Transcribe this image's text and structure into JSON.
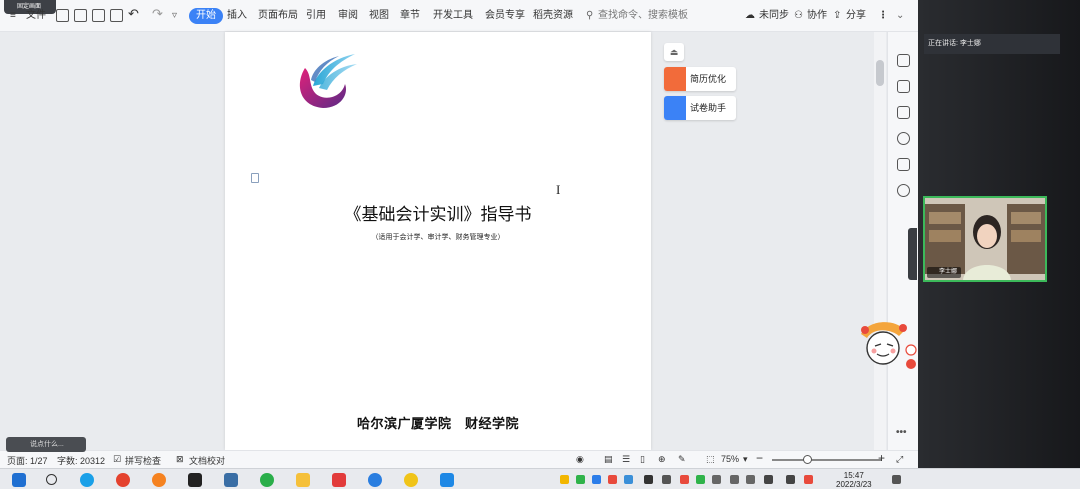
{
  "app": {
    "pin_label": "固定画面",
    "menu": {
      "file": "文件",
      "tabs": [
        "开始",
        "插入",
        "页面布局",
        "引用",
        "审阅",
        "视图",
        "章节",
        "开发工具",
        "会员专享",
        "稻壳资源"
      ],
      "active_tab": "开始"
    },
    "search": {
      "placeholder": "查找命令、搜索模板"
    },
    "actions": {
      "sync": "未同步",
      "collab": "协作",
      "share": "分享"
    }
  },
  "document": {
    "title": "《基础会计实训》指导书",
    "subtitle": "（适用于会计学、审计学、财务管理专业）",
    "school": "哈尔滨广厦学院　财经学院"
  },
  "assistant": {
    "resume": "简历优化",
    "exam": "试卷助手"
  },
  "status": {
    "page": "页面: 1/27",
    "words": "字数: 20312",
    "spell": "拼写检查",
    "proof": "文档校对",
    "zoom": "75%",
    "zoom_fraction": 0.32
  },
  "meeting": {
    "speaking": "正在讲话: 李士娜",
    "participant": "李士娜"
  },
  "tooltip": {
    "text": "说点什么..."
  },
  "taskbar": {
    "time": "15:47",
    "date": "2022/3/23"
  },
  "colors": {
    "accent": "#3b82f6",
    "resume_icon": "#f26b3a",
    "exam_icon": "#3b82f6",
    "video_border": "#3cb95a"
  }
}
